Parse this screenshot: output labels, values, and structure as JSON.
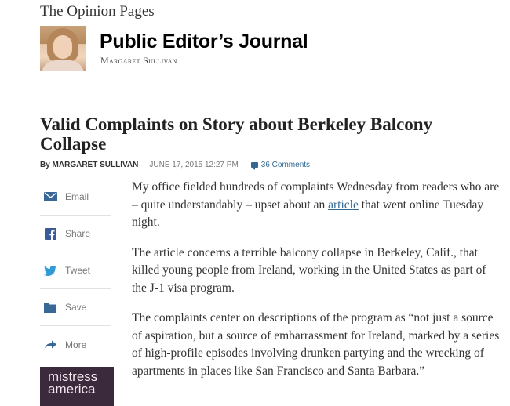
{
  "section_label": "The Opinion Pages",
  "blog": {
    "title": "Public Editor’s Journal",
    "author": "Margaret Sullivan"
  },
  "article": {
    "headline": "Valid Complaints on Story about Berkeley Balcony Collapse",
    "byline_prefix": "By MARGARET SULLIVAN",
    "date": "JUNE 17, 2015 12:27 PM",
    "comments": "36 Comments",
    "paragraphs": {
      "p1_before": "My office fielded hundreds of complaints Wednesday from readers who are – quite understandably – upset about an ",
      "p1_link": "article",
      "p1_after": " that went online Tuesday night.",
      "p2": "The article concerns a terrible balcony collapse in Berkeley, Calif., that killed young people from Ireland, working in the United States as part of the J-1 visa program.",
      "p3": "The complaints center on descriptions of the program as “not just a source of aspiration, but a source of embarrassment for Ireland, marked by a series of high-profile episodes involving drunken partying and the wrecking of apartments in places like San Francisco and Santa Barbara.”"
    }
  },
  "share_tools": [
    {
      "label": "Email",
      "icon": "envelope-icon"
    },
    {
      "label": "Share",
      "icon": "facebook-icon"
    },
    {
      "label": "Tweet",
      "icon": "twitter-bird-icon"
    },
    {
      "label": "Save",
      "icon": "folder-icon"
    },
    {
      "label": "More",
      "icon": "arrow-icon"
    }
  ],
  "ad": {
    "line1": "mistress",
    "line2": "america"
  },
  "colors": {
    "link": "#326891",
    "icon": "#3a6896",
    "ad_bg": "#3b2a3c"
  }
}
